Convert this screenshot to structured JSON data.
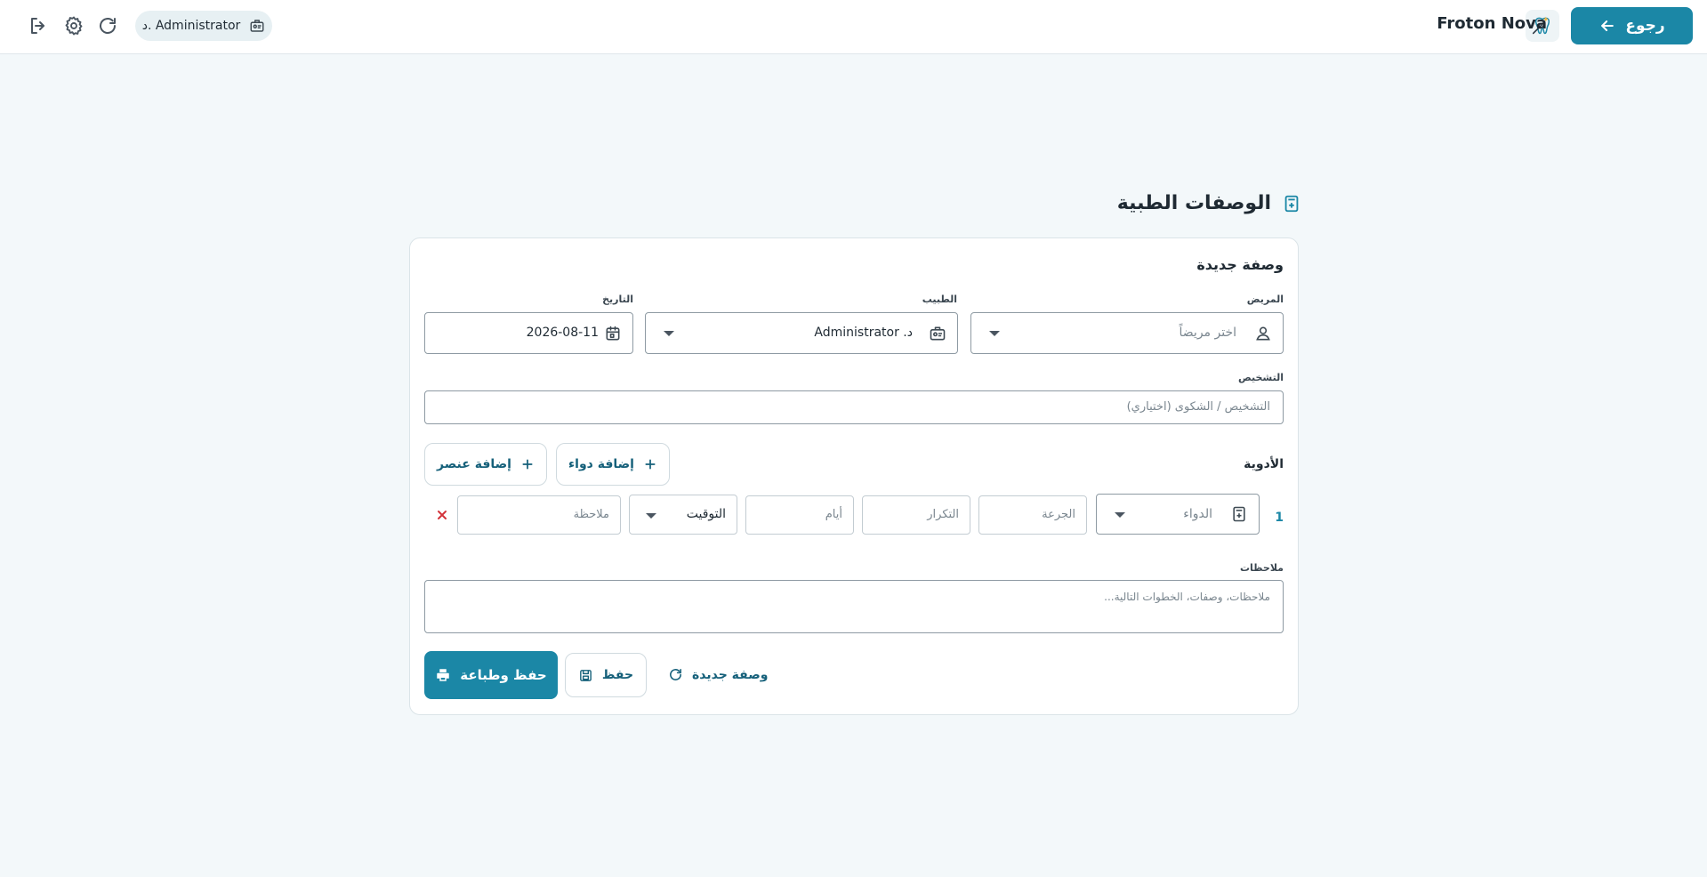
{
  "header": {
    "back_label": "رجوع",
    "app_name": "Froton Nova",
    "user_chip": "د. Administrator",
    "icons": [
      "logout-icon",
      "settings-gear-icon",
      "refresh-icon",
      "doctor-badge-icon",
      "app-logo-icon",
      "arrow-left-icon"
    ]
  },
  "page": {
    "title": "الوصفات الطبية"
  },
  "form": {
    "section_title": "وصفة جديدة",
    "patient": {
      "label": "المريض",
      "placeholder": "اختر مريضاً"
    },
    "doctor": {
      "label": "الطبيب",
      "value": "د. Administrator"
    },
    "date": {
      "label": "التاريخ",
      "value": "2026-08-11"
    },
    "diagnosis": {
      "label": "التشخيص",
      "placeholder": "التشخيص / الشكوى (اختياري)"
    },
    "medications": {
      "label": "الأدوية",
      "add_medicine": "إضافة دواء",
      "add_item": "إضافة عنصر",
      "rows": [
        {
          "index": "1",
          "drug_placeholder": "الدواء",
          "dose_placeholder": "الجرعة",
          "frequency_placeholder": "التكرار",
          "days_placeholder": "أيام",
          "timing_value": "التوقيت",
          "note_placeholder": "ملاحظة"
        }
      ]
    },
    "notes": {
      "label": "ملاحظات",
      "placeholder": "ملاحظات، وصفات، الخطوات التالية..."
    },
    "actions": {
      "save_print": "حفظ وطباعة",
      "save": "حفظ",
      "new_prescription": "وصفة جديدة"
    }
  },
  "colors": {
    "primary": "#1b87a6",
    "link": "#15607a",
    "danger": "#d3333a",
    "background": "#f3f8fa"
  }
}
